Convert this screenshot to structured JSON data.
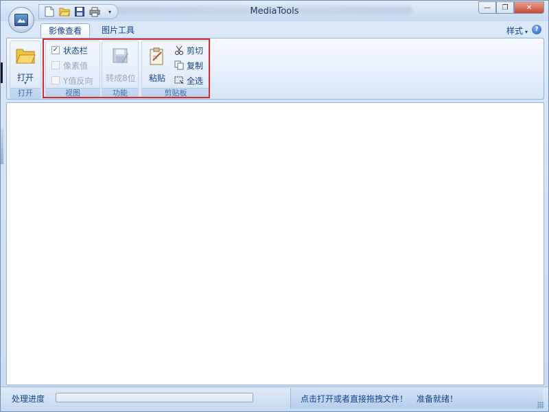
{
  "window": {
    "title": "MediaTools",
    "controls": {
      "minimize": "—",
      "restore": "❐",
      "close": "✕"
    }
  },
  "quick_access": {
    "icons": [
      "new-file-icon",
      "open-folder-icon",
      "save-icon",
      "print-icon"
    ],
    "dropdown": "▾"
  },
  "tabs": [
    {
      "label": "影像查看",
      "active": true
    },
    {
      "label": "图片工具",
      "active": false
    }
  ],
  "style_menu": {
    "label": "样式",
    "arrow": "▾"
  },
  "help": {
    "glyph": "?"
  },
  "ribbon": {
    "open_group": {
      "button_label": "打开",
      "dropdown": "▾",
      "group_label": "打开"
    },
    "view_group": {
      "group_label": "视图",
      "checkboxes": [
        {
          "label": "状态栏",
          "checked": true,
          "enabled": true
        },
        {
          "label": "像素值",
          "checked": false,
          "enabled": false
        },
        {
          "label": "Y值反向",
          "checked": false,
          "enabled": false
        }
      ]
    },
    "function_group": {
      "button_label": "转成8位",
      "group_label": "功能",
      "enabled": false
    },
    "clipboard_group": {
      "group_label": "剪贴板",
      "paste_label": "粘贴",
      "cut_label": "剪切",
      "copy_label": "复制",
      "select_all_label": "全选"
    }
  },
  "status_bar": {
    "progress_label": "处理进度",
    "progress_value": 0,
    "message": "点击打开或者直接拖拽文件！",
    "ready": "准备就绪！"
  },
  "colors": {
    "accent": "#15428b",
    "highlight_box": "#e0262b",
    "ribbon_border": "#8db2e3"
  }
}
